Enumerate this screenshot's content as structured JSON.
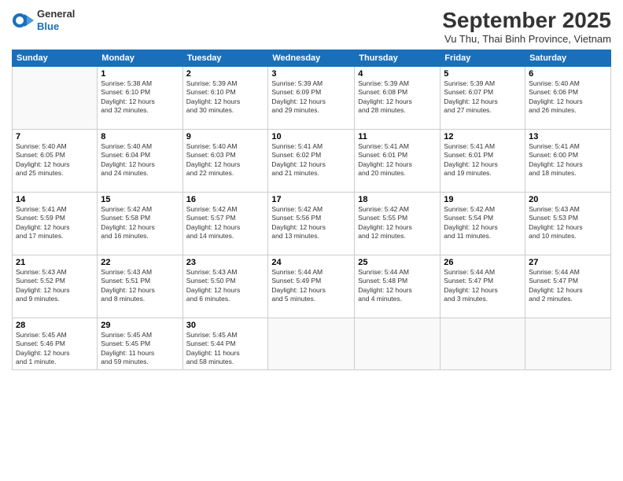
{
  "header": {
    "logo_general": "General",
    "logo_blue": "Blue",
    "title": "September 2025",
    "subtitle": "Vu Thu, Thai Binh Province, Vietnam"
  },
  "days_of_week": [
    "Sunday",
    "Monday",
    "Tuesday",
    "Wednesday",
    "Thursday",
    "Friday",
    "Saturday"
  ],
  "weeks": [
    [
      {
        "num": "",
        "info": ""
      },
      {
        "num": "1",
        "info": "Sunrise: 5:38 AM\nSunset: 6:10 PM\nDaylight: 12 hours\nand 32 minutes."
      },
      {
        "num": "2",
        "info": "Sunrise: 5:39 AM\nSunset: 6:10 PM\nDaylight: 12 hours\nand 30 minutes."
      },
      {
        "num": "3",
        "info": "Sunrise: 5:39 AM\nSunset: 6:09 PM\nDaylight: 12 hours\nand 29 minutes."
      },
      {
        "num": "4",
        "info": "Sunrise: 5:39 AM\nSunset: 6:08 PM\nDaylight: 12 hours\nand 28 minutes."
      },
      {
        "num": "5",
        "info": "Sunrise: 5:39 AM\nSunset: 6:07 PM\nDaylight: 12 hours\nand 27 minutes."
      },
      {
        "num": "6",
        "info": "Sunrise: 5:40 AM\nSunset: 6:06 PM\nDaylight: 12 hours\nand 26 minutes."
      }
    ],
    [
      {
        "num": "7",
        "info": "Sunrise: 5:40 AM\nSunset: 6:05 PM\nDaylight: 12 hours\nand 25 minutes."
      },
      {
        "num": "8",
        "info": "Sunrise: 5:40 AM\nSunset: 6:04 PM\nDaylight: 12 hours\nand 24 minutes."
      },
      {
        "num": "9",
        "info": "Sunrise: 5:40 AM\nSunset: 6:03 PM\nDaylight: 12 hours\nand 22 minutes."
      },
      {
        "num": "10",
        "info": "Sunrise: 5:41 AM\nSunset: 6:02 PM\nDaylight: 12 hours\nand 21 minutes."
      },
      {
        "num": "11",
        "info": "Sunrise: 5:41 AM\nSunset: 6:01 PM\nDaylight: 12 hours\nand 20 minutes."
      },
      {
        "num": "12",
        "info": "Sunrise: 5:41 AM\nSunset: 6:01 PM\nDaylight: 12 hours\nand 19 minutes."
      },
      {
        "num": "13",
        "info": "Sunrise: 5:41 AM\nSunset: 6:00 PM\nDaylight: 12 hours\nand 18 minutes."
      }
    ],
    [
      {
        "num": "14",
        "info": "Sunrise: 5:41 AM\nSunset: 5:59 PM\nDaylight: 12 hours\nand 17 minutes."
      },
      {
        "num": "15",
        "info": "Sunrise: 5:42 AM\nSunset: 5:58 PM\nDaylight: 12 hours\nand 16 minutes."
      },
      {
        "num": "16",
        "info": "Sunrise: 5:42 AM\nSunset: 5:57 PM\nDaylight: 12 hours\nand 14 minutes."
      },
      {
        "num": "17",
        "info": "Sunrise: 5:42 AM\nSunset: 5:56 PM\nDaylight: 12 hours\nand 13 minutes."
      },
      {
        "num": "18",
        "info": "Sunrise: 5:42 AM\nSunset: 5:55 PM\nDaylight: 12 hours\nand 12 minutes."
      },
      {
        "num": "19",
        "info": "Sunrise: 5:42 AM\nSunset: 5:54 PM\nDaylight: 12 hours\nand 11 minutes."
      },
      {
        "num": "20",
        "info": "Sunrise: 5:43 AM\nSunset: 5:53 PM\nDaylight: 12 hours\nand 10 minutes."
      }
    ],
    [
      {
        "num": "21",
        "info": "Sunrise: 5:43 AM\nSunset: 5:52 PM\nDaylight: 12 hours\nand 9 minutes."
      },
      {
        "num": "22",
        "info": "Sunrise: 5:43 AM\nSunset: 5:51 PM\nDaylight: 12 hours\nand 8 minutes."
      },
      {
        "num": "23",
        "info": "Sunrise: 5:43 AM\nSunset: 5:50 PM\nDaylight: 12 hours\nand 6 minutes."
      },
      {
        "num": "24",
        "info": "Sunrise: 5:44 AM\nSunset: 5:49 PM\nDaylight: 12 hours\nand 5 minutes."
      },
      {
        "num": "25",
        "info": "Sunrise: 5:44 AM\nSunset: 5:48 PM\nDaylight: 12 hours\nand 4 minutes."
      },
      {
        "num": "26",
        "info": "Sunrise: 5:44 AM\nSunset: 5:47 PM\nDaylight: 12 hours\nand 3 minutes."
      },
      {
        "num": "27",
        "info": "Sunrise: 5:44 AM\nSunset: 5:47 PM\nDaylight: 12 hours\nand 2 minutes."
      }
    ],
    [
      {
        "num": "28",
        "info": "Sunrise: 5:45 AM\nSunset: 5:46 PM\nDaylight: 12 hours\nand 1 minute."
      },
      {
        "num": "29",
        "info": "Sunrise: 5:45 AM\nSunset: 5:45 PM\nDaylight: 11 hours\nand 59 minutes."
      },
      {
        "num": "30",
        "info": "Sunrise: 5:45 AM\nSunset: 5:44 PM\nDaylight: 11 hours\nand 58 minutes."
      },
      {
        "num": "",
        "info": ""
      },
      {
        "num": "",
        "info": ""
      },
      {
        "num": "",
        "info": ""
      },
      {
        "num": "",
        "info": ""
      }
    ]
  ]
}
